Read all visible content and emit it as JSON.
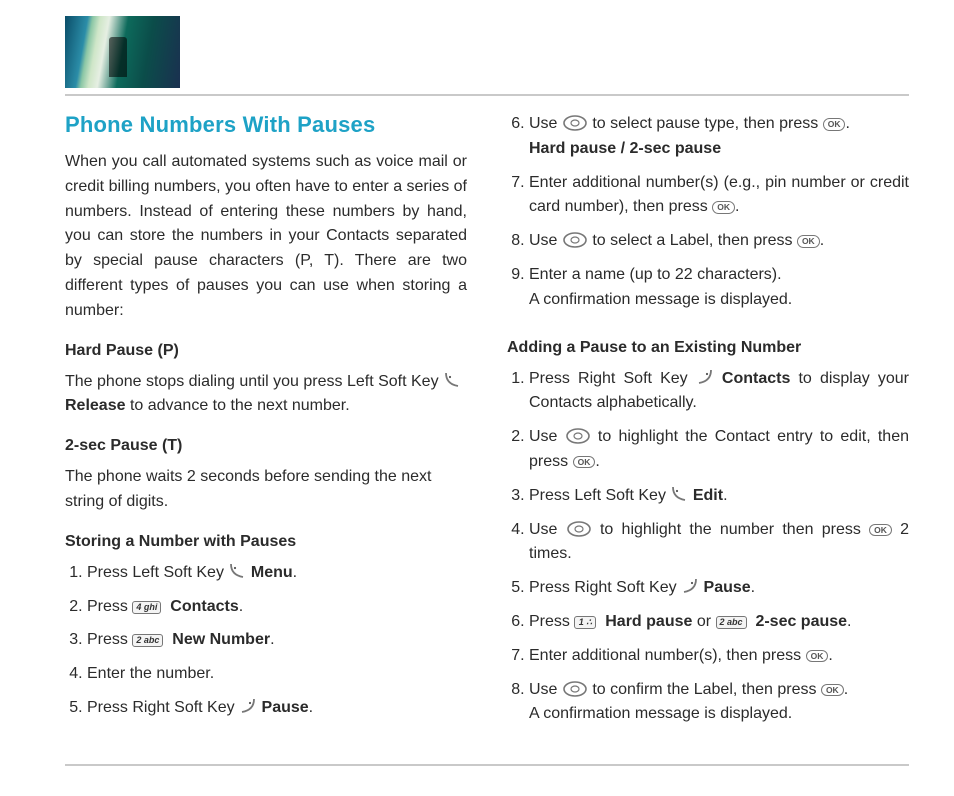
{
  "title": "Phone Numbers With Pauses",
  "intro": "When you call automated systems such as voice mail or credit billing numbers, you often have to enter a series of numbers. Instead of entering these numbers by hand, you can store the numbers in your Contacts separated by special pause characters (P, T). There are two different types of pauses you can use when storing a number:",
  "hard_pause": {
    "label": "Hard Pause (P)",
    "text1": "The phone stops dialing until you press Left Soft Key ",
    "release": "Release",
    "text2": " to advance to the next number."
  },
  "sec_pause": {
    "label": "2-sec Pause (T)",
    "text": "The phone waits 2 seconds before sending the next string of digits."
  },
  "store": {
    "heading": "Storing a Number with Pauses",
    "s1a": "Press Left Soft Key ",
    "s1b": "Menu",
    "s2a": "Press ",
    "s2b": "Contacts",
    "s3a": "Press ",
    "s3b": "New Number",
    "s4": "Enter the number.",
    "s5a": "Press Right Soft Key ",
    "s5b": "Pause"
  },
  "col2": {
    "s6a": "Use ",
    "s6b": " to select pause type, then press ",
    "s6c": "Hard pause / 2-sec pause",
    "s7a": "Enter additional number(s) (e.g., pin number or credit card number), then press ",
    "s8a": "Use ",
    "s8b": " to select a Label, then press ",
    "s9a": "Enter a name (up to 22 characters).",
    "s9b": "A confirmation message is displayed."
  },
  "add": {
    "heading": "Adding a Pause to an Existing Number",
    "s1a": "Press Right Soft Key ",
    "s1b": "Contacts",
    "s1c": " to display your Contacts alphabetically.",
    "s2a": "Use ",
    "s2b": " to highlight the Contact entry to edit, then press ",
    "s3a": "Press Left Soft Key ",
    "s3b": "Edit",
    "s4a": "Use ",
    "s4b": " to highlight the number then press ",
    "s4c": " 2 times.",
    "s5a": "Press Right Soft Key ",
    "s5b": "Pause",
    "s6a": "Press ",
    "s6b": "Hard pause",
    "s6c": " or ",
    "s6d": "2-sec pause",
    "s7a": "Enter additional number(s), then press ",
    "s8a": "Use ",
    "s8b": " to confirm the Label, then press ",
    "s8c": "A confirmation message is displayed."
  },
  "keys": {
    "four": "4 ghi",
    "two": "2 abc",
    "one": "1 ∴"
  },
  "ok": "OK"
}
